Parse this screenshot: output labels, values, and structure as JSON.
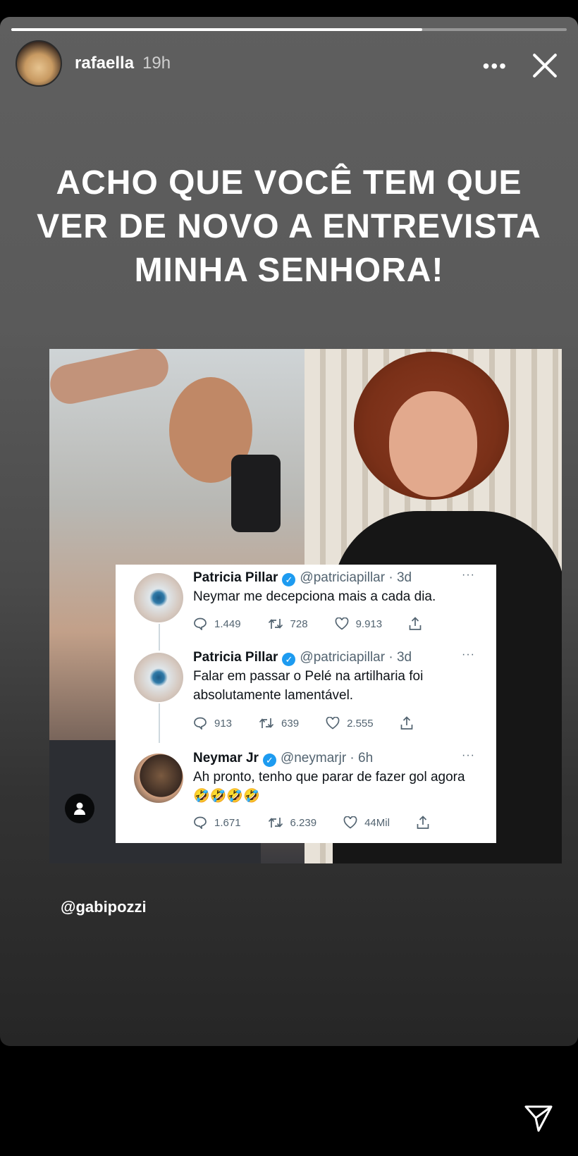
{
  "story": {
    "username": "rafaella",
    "time": "19h",
    "more_label": "•••",
    "progress": 0.74
  },
  "caption": {
    "lines": [
      "ACHO QUE VOCÊ TEM QUE",
      "VER DE NOVO A ENTREVISTA",
      "MINHA SENHORA!"
    ]
  },
  "tweets": [
    {
      "name": "Patricia Pillar",
      "handle": "@patriciapillar · 3d",
      "text": "Neymar me decepciona mais a cada dia.",
      "replies": "1.449",
      "retweets": "728",
      "likes": "9.913"
    },
    {
      "name": "Patricia Pillar",
      "handle": "@patriciapillar · 3d",
      "text": "Falar em passar o Pelé na artilharia foi absolutamente lamentável.",
      "replies": "913",
      "retweets": "639",
      "likes": "2.555"
    },
    {
      "name": "Neymar Jr",
      "handle": "@neymarjr · 6h",
      "text": "Ah pronto, tenho que parar de fazer gol agora 🤣🤣🤣🤣",
      "replies": "1.671",
      "retweets": "6.239",
      "likes": "44Mil"
    }
  ],
  "mention": "@gabipozzi",
  "icons": {
    "close": "close-icon",
    "more": "more-icon",
    "send": "send-icon",
    "user_tag": "person-icon"
  }
}
